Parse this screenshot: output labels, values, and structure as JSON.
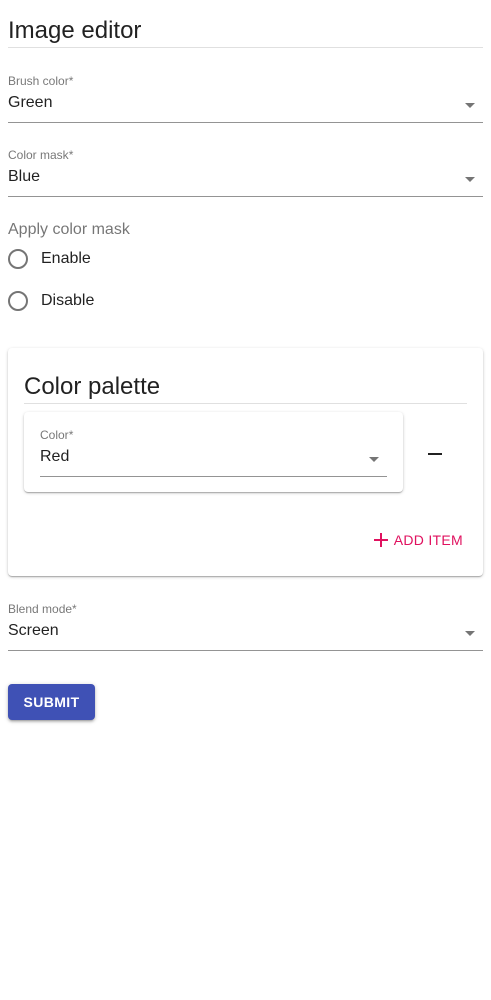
{
  "form": {
    "title": "Image editor",
    "brush_color": {
      "label": "Brush color",
      "required_mark": "*",
      "value": "Green"
    },
    "color_mask": {
      "label": "Color mask",
      "required_mark": "*",
      "value": "Blue"
    },
    "apply_color_mask": {
      "label": "Apply color mask",
      "options": [
        "Enable",
        "Disable"
      ]
    },
    "color_palette": {
      "title": "Color palette",
      "items": [
        {
          "label": "Color",
          "required_mark": "*",
          "value": "Red"
        }
      ],
      "add_label": "ADD ITEM"
    },
    "blend_mode": {
      "label": "Blend mode",
      "required_mark": "*",
      "value": "Screen"
    },
    "submit_label": "SUBMIT"
  },
  "colors": {
    "primary": "#3f51b5",
    "accent": "#e0115f"
  },
  "icons": {
    "dropdown": "triangle-down-icon",
    "remove": "minus-icon",
    "add": "plus-icon"
  }
}
